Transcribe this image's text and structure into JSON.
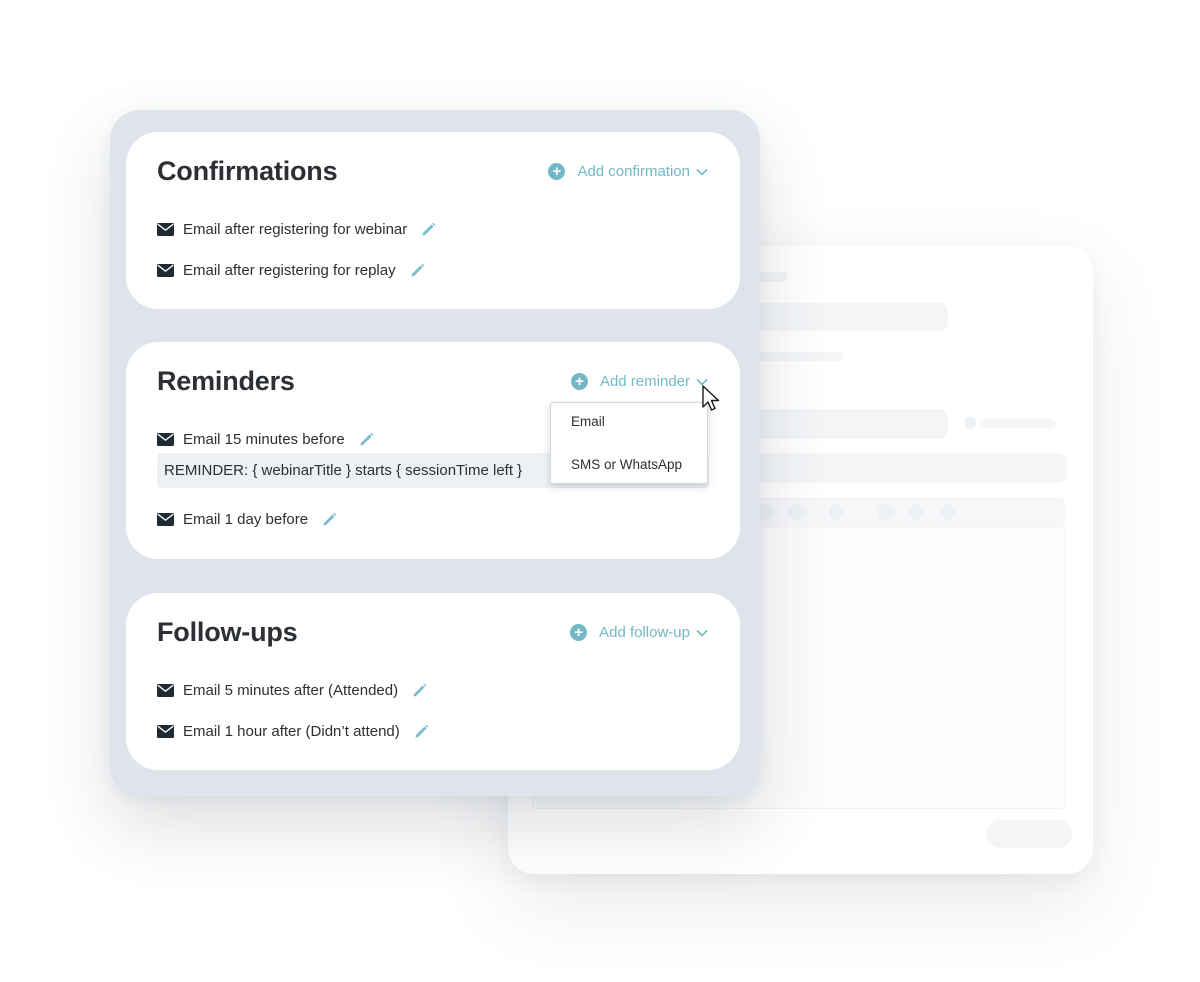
{
  "sections": {
    "confirmations": {
      "title": "Confirmations",
      "add_label": "Add confirmation",
      "items": [
        {
          "label": "Email after registering for webinar"
        },
        {
          "label": "Email after registering for replay"
        }
      ]
    },
    "reminders": {
      "title": "Reminders",
      "add_label": "Add reminder",
      "items": [
        {
          "label": "Email 15 minutes before",
          "preview": "REMINDER: { webinarTitle } starts { sessionTime left }"
        },
        {
          "label": "Email 1 day before"
        }
      ],
      "dropdown": {
        "options": [
          "Email",
          "SMS or WhatsApp"
        ]
      }
    },
    "followups": {
      "title": "Follow-ups",
      "add_label": "Add follow-up",
      "items": [
        {
          "label": "Email 5 minutes after (Attended)"
        },
        {
          "label": "Email 1 hour after (Didn’t attend)"
        }
      ]
    }
  },
  "icons": {
    "add": "plus-circle-icon",
    "expand": "chevron-down-icon",
    "message": "envelope-icon",
    "edit": "pencil-icon",
    "pointer": "mouse-cursor-icon"
  },
  "colors": {
    "accent": "#72b9c5",
    "panel_bg": "#dfe3eb",
    "text": "#2c2f33",
    "preview_bg": "#edf1f6"
  }
}
